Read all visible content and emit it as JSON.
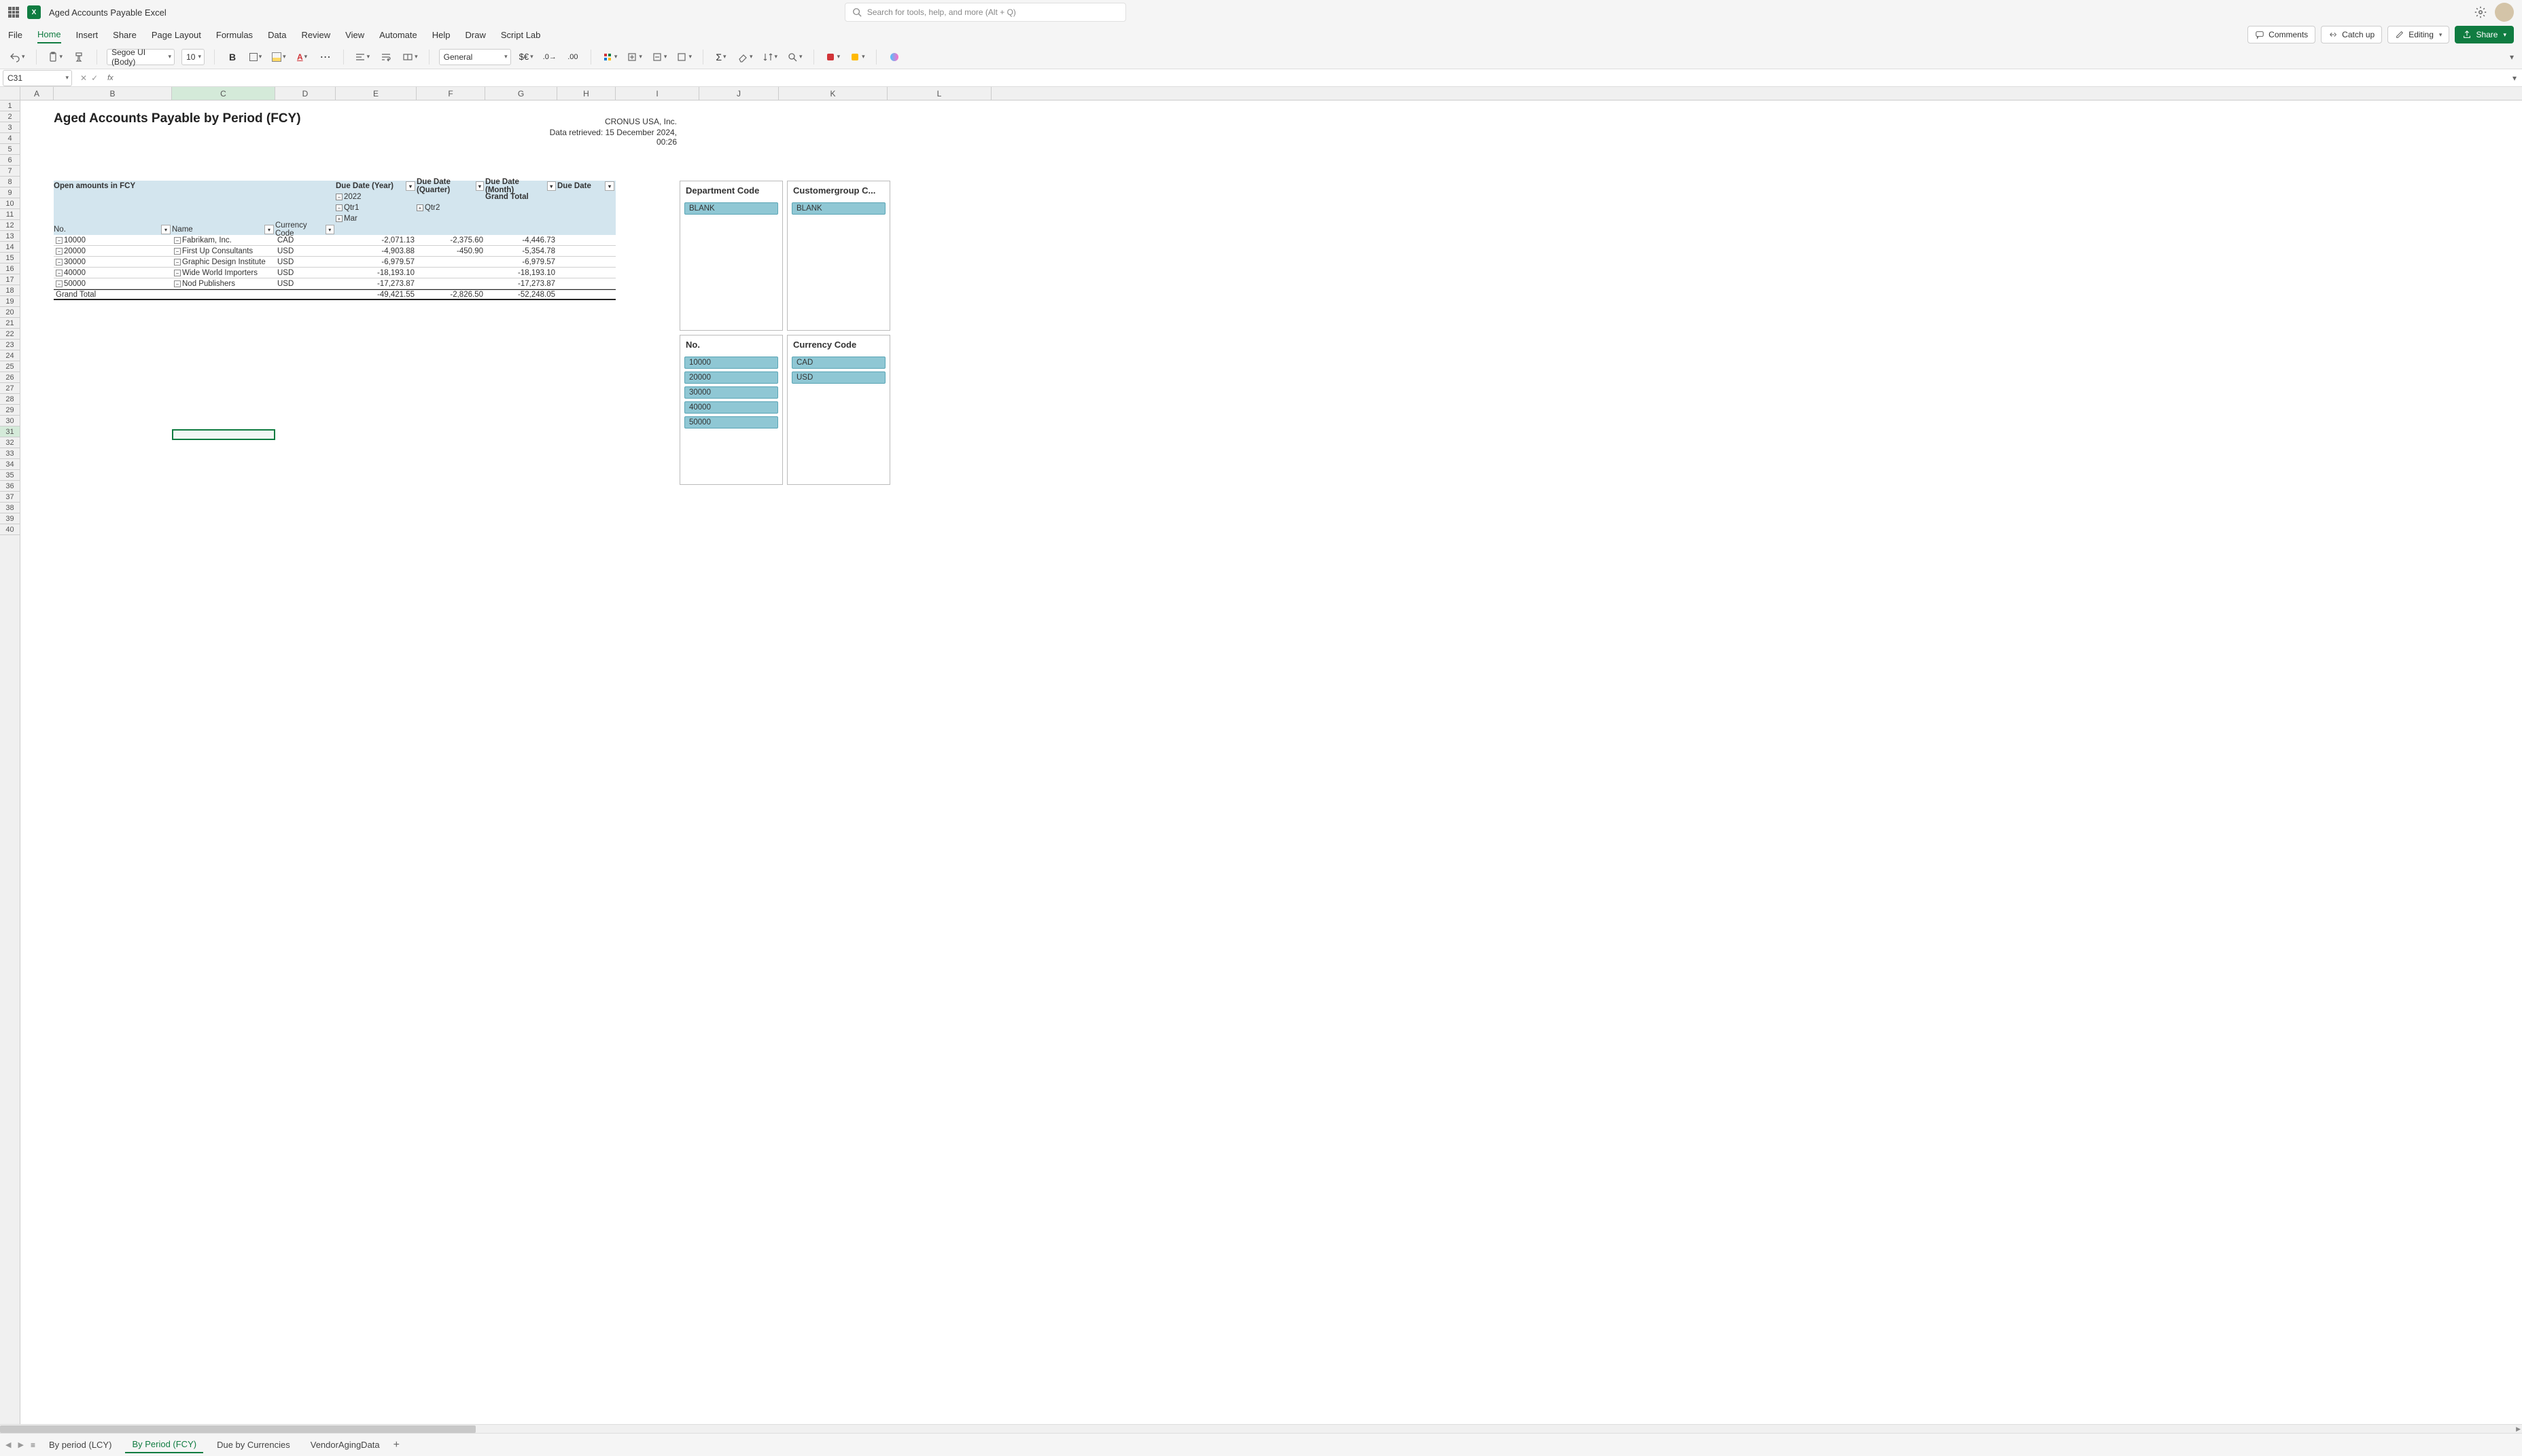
{
  "header": {
    "doc_title": "Aged Accounts Payable Excel",
    "search_placeholder": "Search for tools, help, and more (Alt + Q)"
  },
  "ribbon": {
    "tabs": [
      "File",
      "Home",
      "Insert",
      "Share",
      "Page Layout",
      "Formulas",
      "Data",
      "Review",
      "View",
      "Automate",
      "Help",
      "Draw",
      "Script Lab"
    ],
    "active_tab": "Home",
    "comments": "Comments",
    "catchup": "Catch up",
    "editing": "Editing",
    "share": "Share"
  },
  "toolbar": {
    "font": "Segoe UI (Body)",
    "size": "10",
    "bold": "B",
    "number_format": "General"
  },
  "formula_bar": {
    "cell_ref": "C31",
    "fx": "fx",
    "value": ""
  },
  "columns": [
    "A",
    "B",
    "C",
    "D",
    "E",
    "F",
    "G",
    "H",
    "I",
    "J",
    "K",
    "L"
  ],
  "selected_column": "C",
  "selected_row": 31,
  "row_count": 40,
  "report": {
    "title": "Aged Accounts Payable by Period (FCY)",
    "company": "CRONUS USA, Inc.",
    "retrieved": "Data retrieved: 15 December 2024, 00:26"
  },
  "pivot": {
    "open_label": "Open amounts in FCY",
    "col_year": "Due Date (Year)",
    "col_quarter": "Due Date (Quarter)",
    "col_month": "Due Date (Month)",
    "col_due": "Due Date",
    "year_val": "2022",
    "qtr1_val": "Qtr1",
    "qtr2_val": "Qtr2",
    "mar_val": "Mar",
    "grand_total_label": "Grand Total",
    "row_headers": {
      "no": "No.",
      "name": "Name",
      "currency": "Currency Code"
    },
    "rows": [
      {
        "no": "10000",
        "name": "Fabrikam, Inc.",
        "cur": "CAD",
        "e": "-2,071.13",
        "f": "-2,375.60",
        "g": "-4,446.73"
      },
      {
        "no": "20000",
        "name": "First Up Consultants",
        "cur": "USD",
        "e": "-4,903.88",
        "f": "-450.90",
        "g": "-5,354.78"
      },
      {
        "no": "30000",
        "name": "Graphic Design Institute",
        "cur": "USD",
        "e": "-6,979.57",
        "f": "",
        "g": "-6,979.57"
      },
      {
        "no": "40000",
        "name": "Wide World Importers",
        "cur": "USD",
        "e": "-18,193.10",
        "f": "",
        "g": "-18,193.10"
      },
      {
        "no": "50000",
        "name": "Nod Publishers",
        "cur": "USD",
        "e": "-17,273.87",
        "f": "",
        "g": "-17,273.87"
      }
    ],
    "grand_total": {
      "label": "Grand Total",
      "e": "-49,421.55",
      "f": "-2,826.50",
      "g": "-52,248.05"
    }
  },
  "slicers": {
    "dept": {
      "title": "Department Code",
      "items": [
        "BLANK"
      ]
    },
    "cust": {
      "title": "Customergroup C...",
      "items": [
        "BLANK"
      ]
    },
    "no": {
      "title": "No.",
      "items": [
        "10000",
        "20000",
        "30000",
        "40000",
        "50000"
      ]
    },
    "cur": {
      "title": "Currency Code",
      "items": [
        "CAD",
        "USD"
      ]
    }
  },
  "sheets": {
    "tabs": [
      "By period (LCY)",
      "By Period (FCY)",
      "Due by Currencies",
      "VendorAgingData"
    ],
    "active": "By Period (FCY)"
  }
}
